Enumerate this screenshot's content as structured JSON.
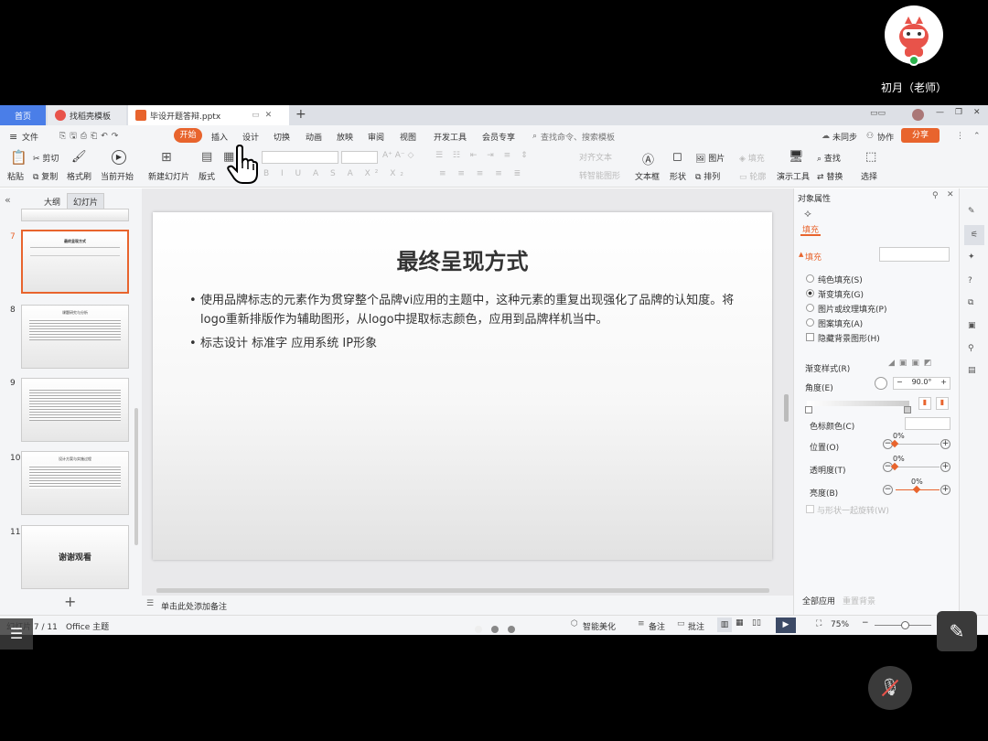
{
  "teacher": {
    "name": "初月（老师）"
  },
  "tabs": [
    {
      "label": "首页"
    },
    {
      "label": "找稻壳模板"
    },
    {
      "label": "毕设开题答辩.pptx"
    }
  ],
  "menu": {
    "file": "文件",
    "items": [
      "开始",
      "插入",
      "设计",
      "切换",
      "动画",
      "放映",
      "审阅",
      "视图",
      "开发工具",
      "会员专享"
    ],
    "search_placeholder": "查找命令、搜索模板",
    "sync": "未同步",
    "collab": "协作",
    "share": "分享"
  },
  "ribbon": {
    "paste": "粘贴",
    "cut": "剪切",
    "copy": "复制",
    "format_painter": "格式刷",
    "start_from_current": "当前开始",
    "new_slide": "新建幻灯片",
    "layout": "版式",
    "align_text": "对齐文本",
    "smart_art": "转智能图形",
    "textbox": "文本框",
    "shape": "形状",
    "picture": "图片",
    "arrange": "排列",
    "fill": "填充",
    "outline": "轮廓",
    "presenter_tools": "演示工具",
    "find": "查找",
    "replace": "替换",
    "select": "选择"
  },
  "left_panel": {
    "tab_outline": "大纲",
    "tab_slides": "幻灯片",
    "slides": [
      {
        "num": "7",
        "title": "最终呈现方式"
      },
      {
        "num": "8",
        "title": "课题研究与分析"
      },
      {
        "num": "9",
        "title": ""
      },
      {
        "num": "10",
        "title": "设计方案与实施过程"
      },
      {
        "num": "11",
        "title": "谢谢观看"
      }
    ]
  },
  "slide": {
    "title": "最终呈现方式",
    "bullets": [
      "使用品牌标志的元素作为贯穿整个品牌vi应用的主题中，这种元素的重复出现强化了品牌的认知度。将logo重新排版作为辅助图形，从logo中提取标志颜色，应用到品牌样机当中。",
      "标志设计 标准字 应用系统 IP形象"
    ]
  },
  "notes_placeholder": "单击此处添加备注",
  "props": {
    "header": "对象属性",
    "tab": "填充",
    "section": "填充",
    "options": [
      "纯色填充(S)",
      "渐变填充(G)",
      "图片或纹理填充(P)",
      "图案填充(A)"
    ],
    "selected": 1,
    "hide_bg": "隐藏背景图形(H)",
    "gradient_style": "渐变样式(R)",
    "angle_label": "角度(E)",
    "angle_value": "90.0°",
    "stop_color": "色标颜色(C)",
    "position_label": "位置(O)",
    "position_value": "0%",
    "transparency_label": "透明度(T)",
    "transparency_value": "0%",
    "brightness_label": "亮度(B)",
    "brightness_value": "0%",
    "rotate_with_shape": "与形状一起旋转(W)",
    "apply_all": "全部应用",
    "reset_bg": "重置背景"
  },
  "status": {
    "slide_info": "幻灯片 7 / 11",
    "theme": "Office 主题",
    "beautify": "智能美化",
    "notes": "备注",
    "comments": "批注",
    "zoom": "75%"
  },
  "colors": {
    "accent": "#e8642d",
    "home_tab": "#4a7ee8"
  }
}
